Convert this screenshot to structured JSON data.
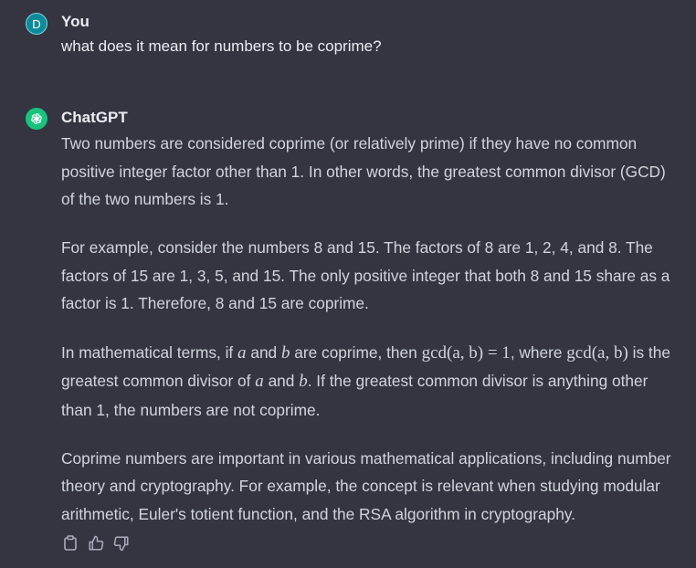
{
  "user": {
    "avatar_letter": "D",
    "name": "You",
    "message": "what does it mean for numbers to be coprime?"
  },
  "assistant": {
    "name": "ChatGPT",
    "paragraphs": {
      "p1": "Two numbers are considered coprime (or relatively prime) if they have no common positive integer factor other than 1. In other words, the greatest common divisor (GCD) of the two numbers is 1.",
      "p2": "For example, consider the numbers 8 and 15. The factors of 8 are 1, 2, 4, and 8. The factors of 15 are 1, 3, 5, and 15. The only positive integer that both 8 and 15 share as a factor is 1. Therefore, 8 and 15 are coprime.",
      "p3": {
        "t1": "In mathematical terms, if ",
        "m_a": "a",
        "t2": " and ",
        "m_b": "b",
        "t3": " are coprime, then ",
        "m_gcd1": "gcd",
        "m_args1": "(a, b) = 1",
        "t4": ", where ",
        "m_gcd2": "gcd",
        "m_args2": "(a, b)",
        "t5": " is the greatest common divisor of ",
        "m_a2": "a",
        "t6": " and ",
        "m_b2": "b",
        "t7": ". If the greatest common divisor is anything other than 1, the numbers are not coprime."
      },
      "p4": "Coprime numbers are important in various mathematical applications, including number theory and cryptography. For example, the concept is relevant when studying modular arithmetic, Euler's totient function, and the RSA algorithm in cryptography."
    },
    "actions": [
      "copy-icon",
      "thumbs-up-icon",
      "thumbs-down-icon"
    ]
  },
  "colors": {
    "background": "#343541",
    "text": "#d1d5db",
    "user_avatar": "#0d8b9a",
    "assistant_avatar": "#19c37d"
  }
}
